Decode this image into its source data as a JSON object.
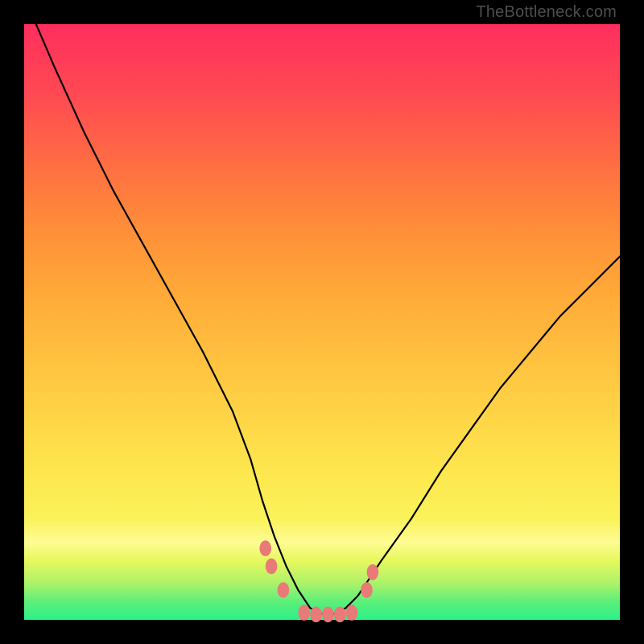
{
  "watermark": "TheBottleneck.com",
  "chart_data": {
    "type": "line",
    "title": "",
    "xlabel": "",
    "ylabel": "",
    "xlim": [
      0,
      100
    ],
    "ylim": [
      0,
      100
    ],
    "series": [
      {
        "name": "bottleneck-curve",
        "x": [
          2,
          5,
          10,
          15,
          20,
          25,
          30,
          35,
          38,
          40,
          42,
          44,
          46,
          48,
          50,
          52,
          54,
          56,
          58,
          60,
          65,
          70,
          75,
          80,
          85,
          90,
          95,
          100
        ],
        "values": [
          100,
          93,
          82,
          72,
          63,
          54,
          45,
          35,
          27,
          20,
          14,
          9,
          5,
          2,
          1,
          1,
          2,
          4,
          7,
          10,
          17,
          25,
          32,
          39,
          45,
          51,
          56,
          61
        ]
      }
    ],
    "markers": {
      "name": "bottom-dots",
      "color": "#e97a77",
      "points_x": [
        40.5,
        41.5,
        43.5,
        47,
        49,
        51,
        53,
        55,
        57.5,
        58.5
      ],
      "points_y": [
        12,
        9,
        5,
        1.2,
        0.9,
        0.9,
        0.9,
        1.2,
        5,
        8
      ]
    },
    "background_gradient": {
      "top": "#ff2e5e",
      "mid": "#fed747",
      "bottom": "#2df08a"
    }
  }
}
